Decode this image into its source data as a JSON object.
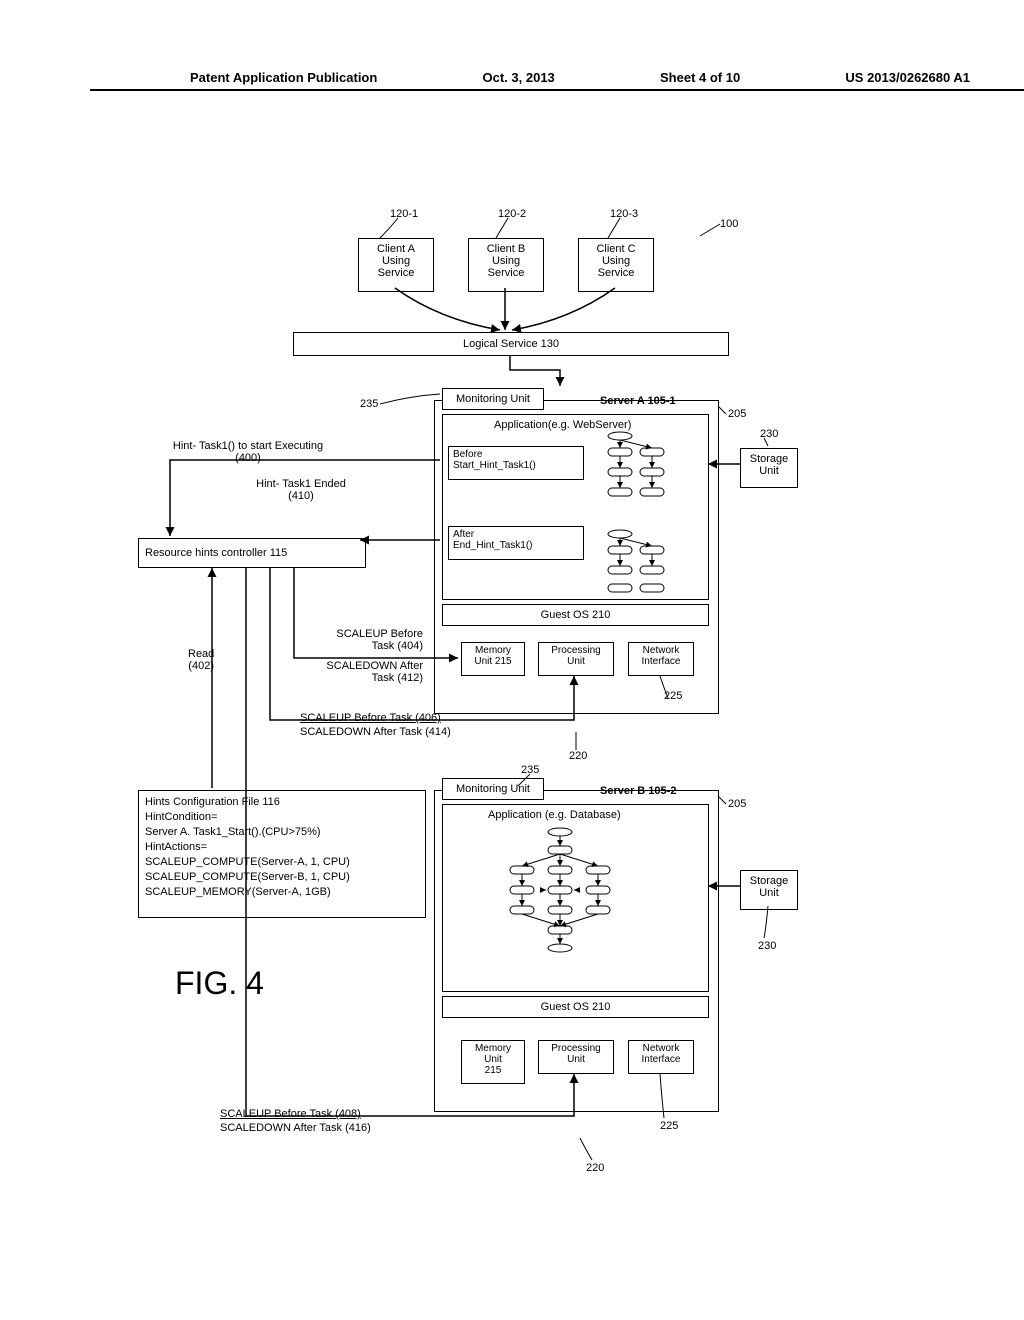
{
  "header": {
    "left": "Patent Application Publication",
    "date": "Oct. 3, 2013",
    "sheet": "Sheet 4 of 10",
    "pubno": "US 2013/0262680 A1"
  },
  "labels": {
    "l1201": "120-1",
    "l1202": "120-2",
    "l1203": "120-3",
    "l100": "100",
    "clientA": "Client A\nUsing\nService",
    "clientB": "Client B\nUsing\nService",
    "clientC": "Client C\nUsing\nService",
    "logical": "Logical Service  130",
    "l235a": "235",
    "monUnit": "Monitoring Unit",
    "serverA": "Server A  105-1",
    "l205a": "205",
    "appA": "Application(e.g. WebServer)",
    "l230a": "230",
    "storage": "Storage\nUnit",
    "before": "Before\nStart_Hint_Task1()",
    "after": "After\nEnd_Hint_Task1()",
    "hintStart": "Hint- Task1() to start Executing\n(400)",
    "hintEnd": "Hint- Task1 Ended\n(410)",
    "rhc": "Resource hints controller 115",
    "guestA": "Guest OS  210",
    "scaleup404": "SCALEUP Before\nTask (404)",
    "scaledown412": "SCALEDOWN After\nTask (412)",
    "read402": "Read\n(402)",
    "memUnit": "Memory\nUnit 215",
    "procUnit": "Processing\nUnit",
    "netIf": "Network\nInterface",
    "l220a": "220",
    "l225a": "225",
    "scaleup406": "SCALEUP Before Task (406)",
    "scaledown414": "SCALEDOWN After Task (414)",
    "l235b": "235",
    "serverB": "Server B  105-2",
    "l205b": "205",
    "appB": "Application (e.g. Database)",
    "hintsFile": "Hints Configuration File 116\nHintCondition=\nServer A. Task1_Start().(CPU>75%)\nHintActions=\nSCALEUP_COMPUTE(Server-A, 1, CPU)\nSCALEUP_COMPUTE(Server-B, 1, CPU)\nSCALEUP_MEMORY(Server-A, 1GB)",
    "l230b": "230",
    "guestB": "Guest OS  210",
    "memUnitB": "Memory\nUnit\n215",
    "l220b": "220",
    "l225b": "225",
    "scaleup408": "SCALEUP Before Task (408)",
    "scaledown416": "SCALEDOWN After Task (416)",
    "fig": "FIG. 4"
  }
}
